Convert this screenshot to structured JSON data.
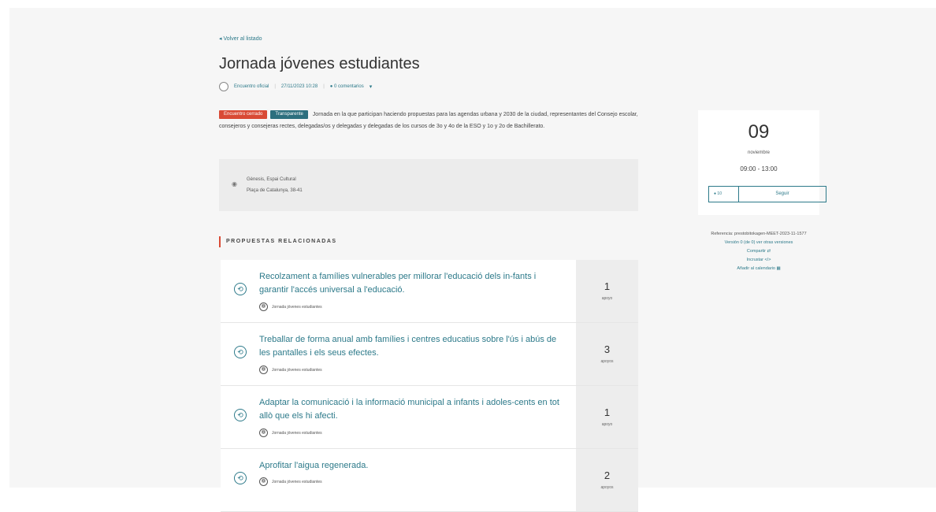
{
  "header": {
    "back_link": "◂ Volver al listado",
    "title": "Jornada jóvenes estudiantes",
    "author": "Encuentro oficial",
    "date": "27/11/2023 10:28",
    "comments": "● 0 comentarios",
    "comments_chevron": "▾"
  },
  "badges": {
    "status": "Encuentro cerrado",
    "category": "Transparente"
  },
  "description": "Jornada en la que participan haciendo propuestas para las agendas urbana y 2030 de la ciudad, representantes del Consejo escolar, consejeros y consejeras rectes, delegadas/os y delegadas y delegadas de los cursos de 3o y 4o de la ESO y 1o y 2o de Bachillerato.",
  "address": {
    "icon": "map-pin-icon",
    "line1": "Gènesis, Espai Cultural",
    "line2": "Plaça de Catalunya, 38-41"
  },
  "section_title": "PROPUESTAS RELACIONADAS",
  "proposals": [
    {
      "title": "Recolzament a famílies vulnerables per millorar l'educació dels in-fants i garantir l'accés universal a l'educació.",
      "tag": "Jornada jóvenes estudiantes",
      "count": "1",
      "count_label": "apoyo"
    },
    {
      "title": "Treballar de forma anual amb famílies i centres educatius sobre l'ús i abús de les pantalles i els seus efectes.",
      "tag": "Jornada jóvenes estudiantes",
      "count": "3",
      "count_label": "apoyos"
    },
    {
      "title": "Adaptar la comunicació i la informació municipal a infants i adoles-cents en tot allò que els hi afecti.",
      "tag": "Jornada jóvenes estudiantes",
      "count": "1",
      "count_label": "apoyo"
    },
    {
      "title": "Aprofitar l'aigua regenerada.",
      "tag": "Jornada jóvenes estudiantes",
      "count": "2",
      "count_label": "apoyos"
    }
  ],
  "sidebar": {
    "day": "09",
    "month": "noviembre",
    "hours": "09:00 - 13:00",
    "follow_count": "● 10",
    "follow_label": "Seguir",
    "reference": "Referencia: prestobitokagen-MEET-2023-11-1577",
    "version": "Versión 0 (de 0) ver otras versiones",
    "share": "Compartir ⇄",
    "embed": "Incrustar </>",
    "calendar": "Añadir al calendario ▦"
  },
  "colors": {
    "accent": "#2d7a8a",
    "badge_red": "#d94a35",
    "badge_teal": "#2c6f7e",
    "background": "#f6f6f6"
  }
}
